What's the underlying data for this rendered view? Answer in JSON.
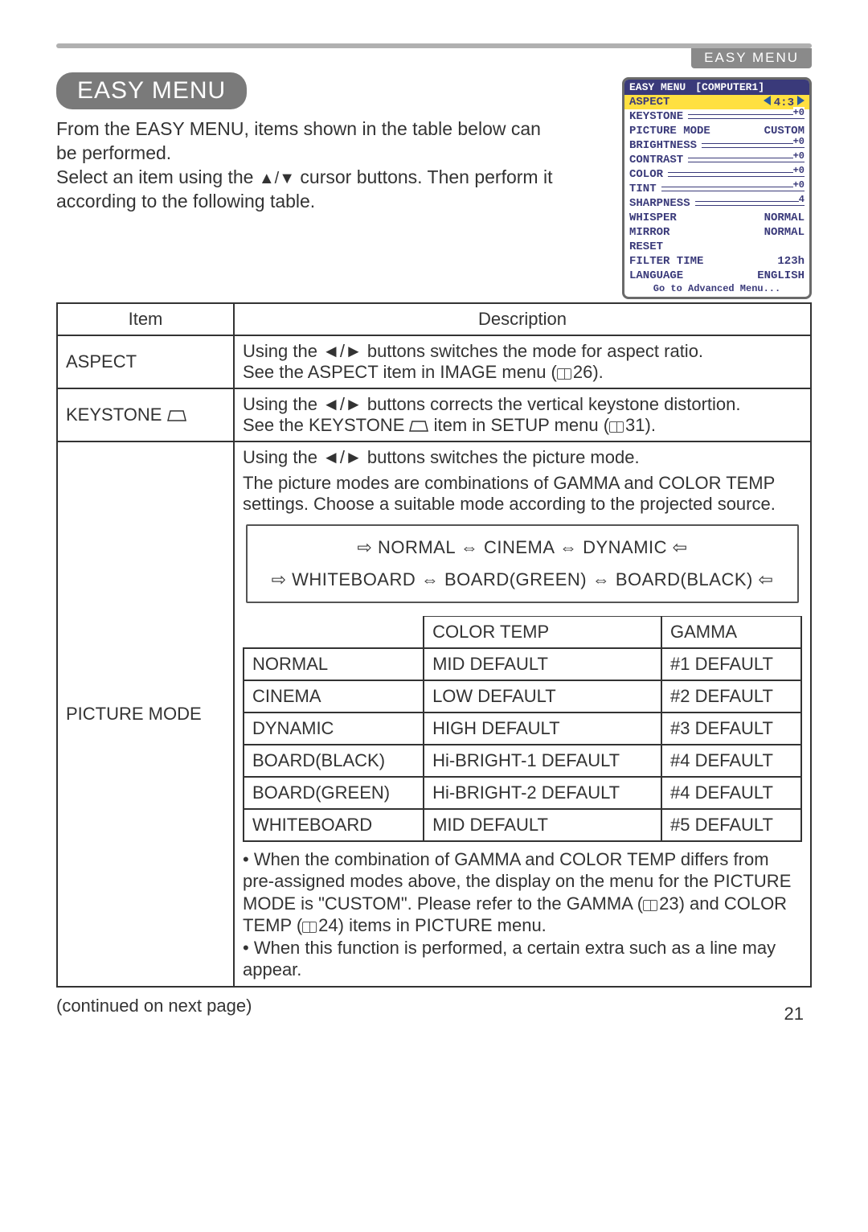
{
  "header_tab": "EASY MENU",
  "section_title": "EASY MENU",
  "intro_line1": "From the EASY MENU, items shown in the table below can be performed.",
  "intro_line2_a": "Select an item using the ",
  "intro_line2_b": " cursor buttons. Then perform it according to the following table.",
  "osd": {
    "header_left": "EASY MENU",
    "header_right": "[COMPUTER1]",
    "rows": [
      {
        "label": "ASPECT",
        "value": "4:3",
        "type": "arrows",
        "hl": true
      },
      {
        "label": "KEYSTONE",
        "value": "+0",
        "type": "slider"
      },
      {
        "label": "PICTURE MODE",
        "value": "CUSTOM",
        "type": "text"
      },
      {
        "label": "BRIGHTNESS",
        "value": "+0",
        "type": "slider"
      },
      {
        "label": "CONTRAST",
        "value": "+0",
        "type": "slider"
      },
      {
        "label": "COLOR",
        "value": "+0",
        "type": "slider"
      },
      {
        "label": "TINT",
        "value": "+0",
        "type": "slider"
      },
      {
        "label": "SHARPNESS",
        "value": "4",
        "type": "slider"
      },
      {
        "label": "WHISPER",
        "value": "NORMAL",
        "type": "text"
      },
      {
        "label": "MIRROR",
        "value": "NORMAL",
        "type": "text"
      },
      {
        "label": "RESET",
        "value": "",
        "type": "text"
      },
      {
        "label": "FILTER TIME",
        "value": "123h",
        "type": "text"
      },
      {
        "label": "LANGUAGE",
        "value": "ENGLISH",
        "type": "text"
      }
    ],
    "go": "Go to Advanced Menu..."
  },
  "table": {
    "head_item": "Item",
    "head_desc": "Description",
    "aspect": {
      "item": "ASPECT",
      "d1": "Using the ◄/► buttons switches the mode for aspect ratio.",
      "d2a": "See the ASPECT item in IMAGE menu (",
      "d2b": "26)."
    },
    "keystone": {
      "item": "KEYSTONE ",
      "d1": "Using the ◄/► buttons corrects the vertical keystone distortion.",
      "d2a": "See the KEYSTONE ",
      "d2b": " item in SETUP menu (",
      "d2c": "31)."
    },
    "picture": {
      "item": "PICTURE MODE",
      "p1": "Using the ◄/► buttons switches the picture mode.",
      "p2": "The picture modes are combinations of GAMMA and COLOR TEMP settings. Choose a suitable mode according to the projected source.",
      "cycle1": "NORMAL ⇔ CINEMA ⇔ DYNAMIC",
      "cycle2": "WHITEBOARD ⇔ BOARD(GREEN) ⇔ BOARD(BLACK)",
      "inner_head": [
        "",
        "COLOR TEMP",
        "GAMMA"
      ],
      "inner_rows": [
        [
          "NORMAL",
          "MID DEFAULT",
          "#1 DEFAULT"
        ],
        [
          "CINEMA",
          "LOW DEFAULT",
          "#2 DEFAULT"
        ],
        [
          "DYNAMIC",
          "HIGH DEFAULT",
          "#3 DEFAULT"
        ],
        [
          "BOARD(BLACK)",
          "Hi-BRIGHT-1 DEFAULT",
          "#4 DEFAULT"
        ],
        [
          "BOARD(GREEN)",
          "Hi-BRIGHT-2 DEFAULT",
          "#4 DEFAULT"
        ],
        [
          "WHITEBOARD",
          "MID DEFAULT",
          "#5 DEFAULT"
        ]
      ],
      "note1a": "• When the combination of GAMMA and COLOR TEMP differs from pre-assigned modes above, the display on the menu for the PICTURE MODE is \"CUSTOM\". Please refer to the GAMMA (",
      "note1b": "23) and COLOR TEMP (",
      "note1c": "24) items in PICTURE menu.",
      "note2": "• When this function is performed, a certain extra such as a line may appear."
    }
  },
  "continued": "(continued on next page)",
  "page_number": "21"
}
